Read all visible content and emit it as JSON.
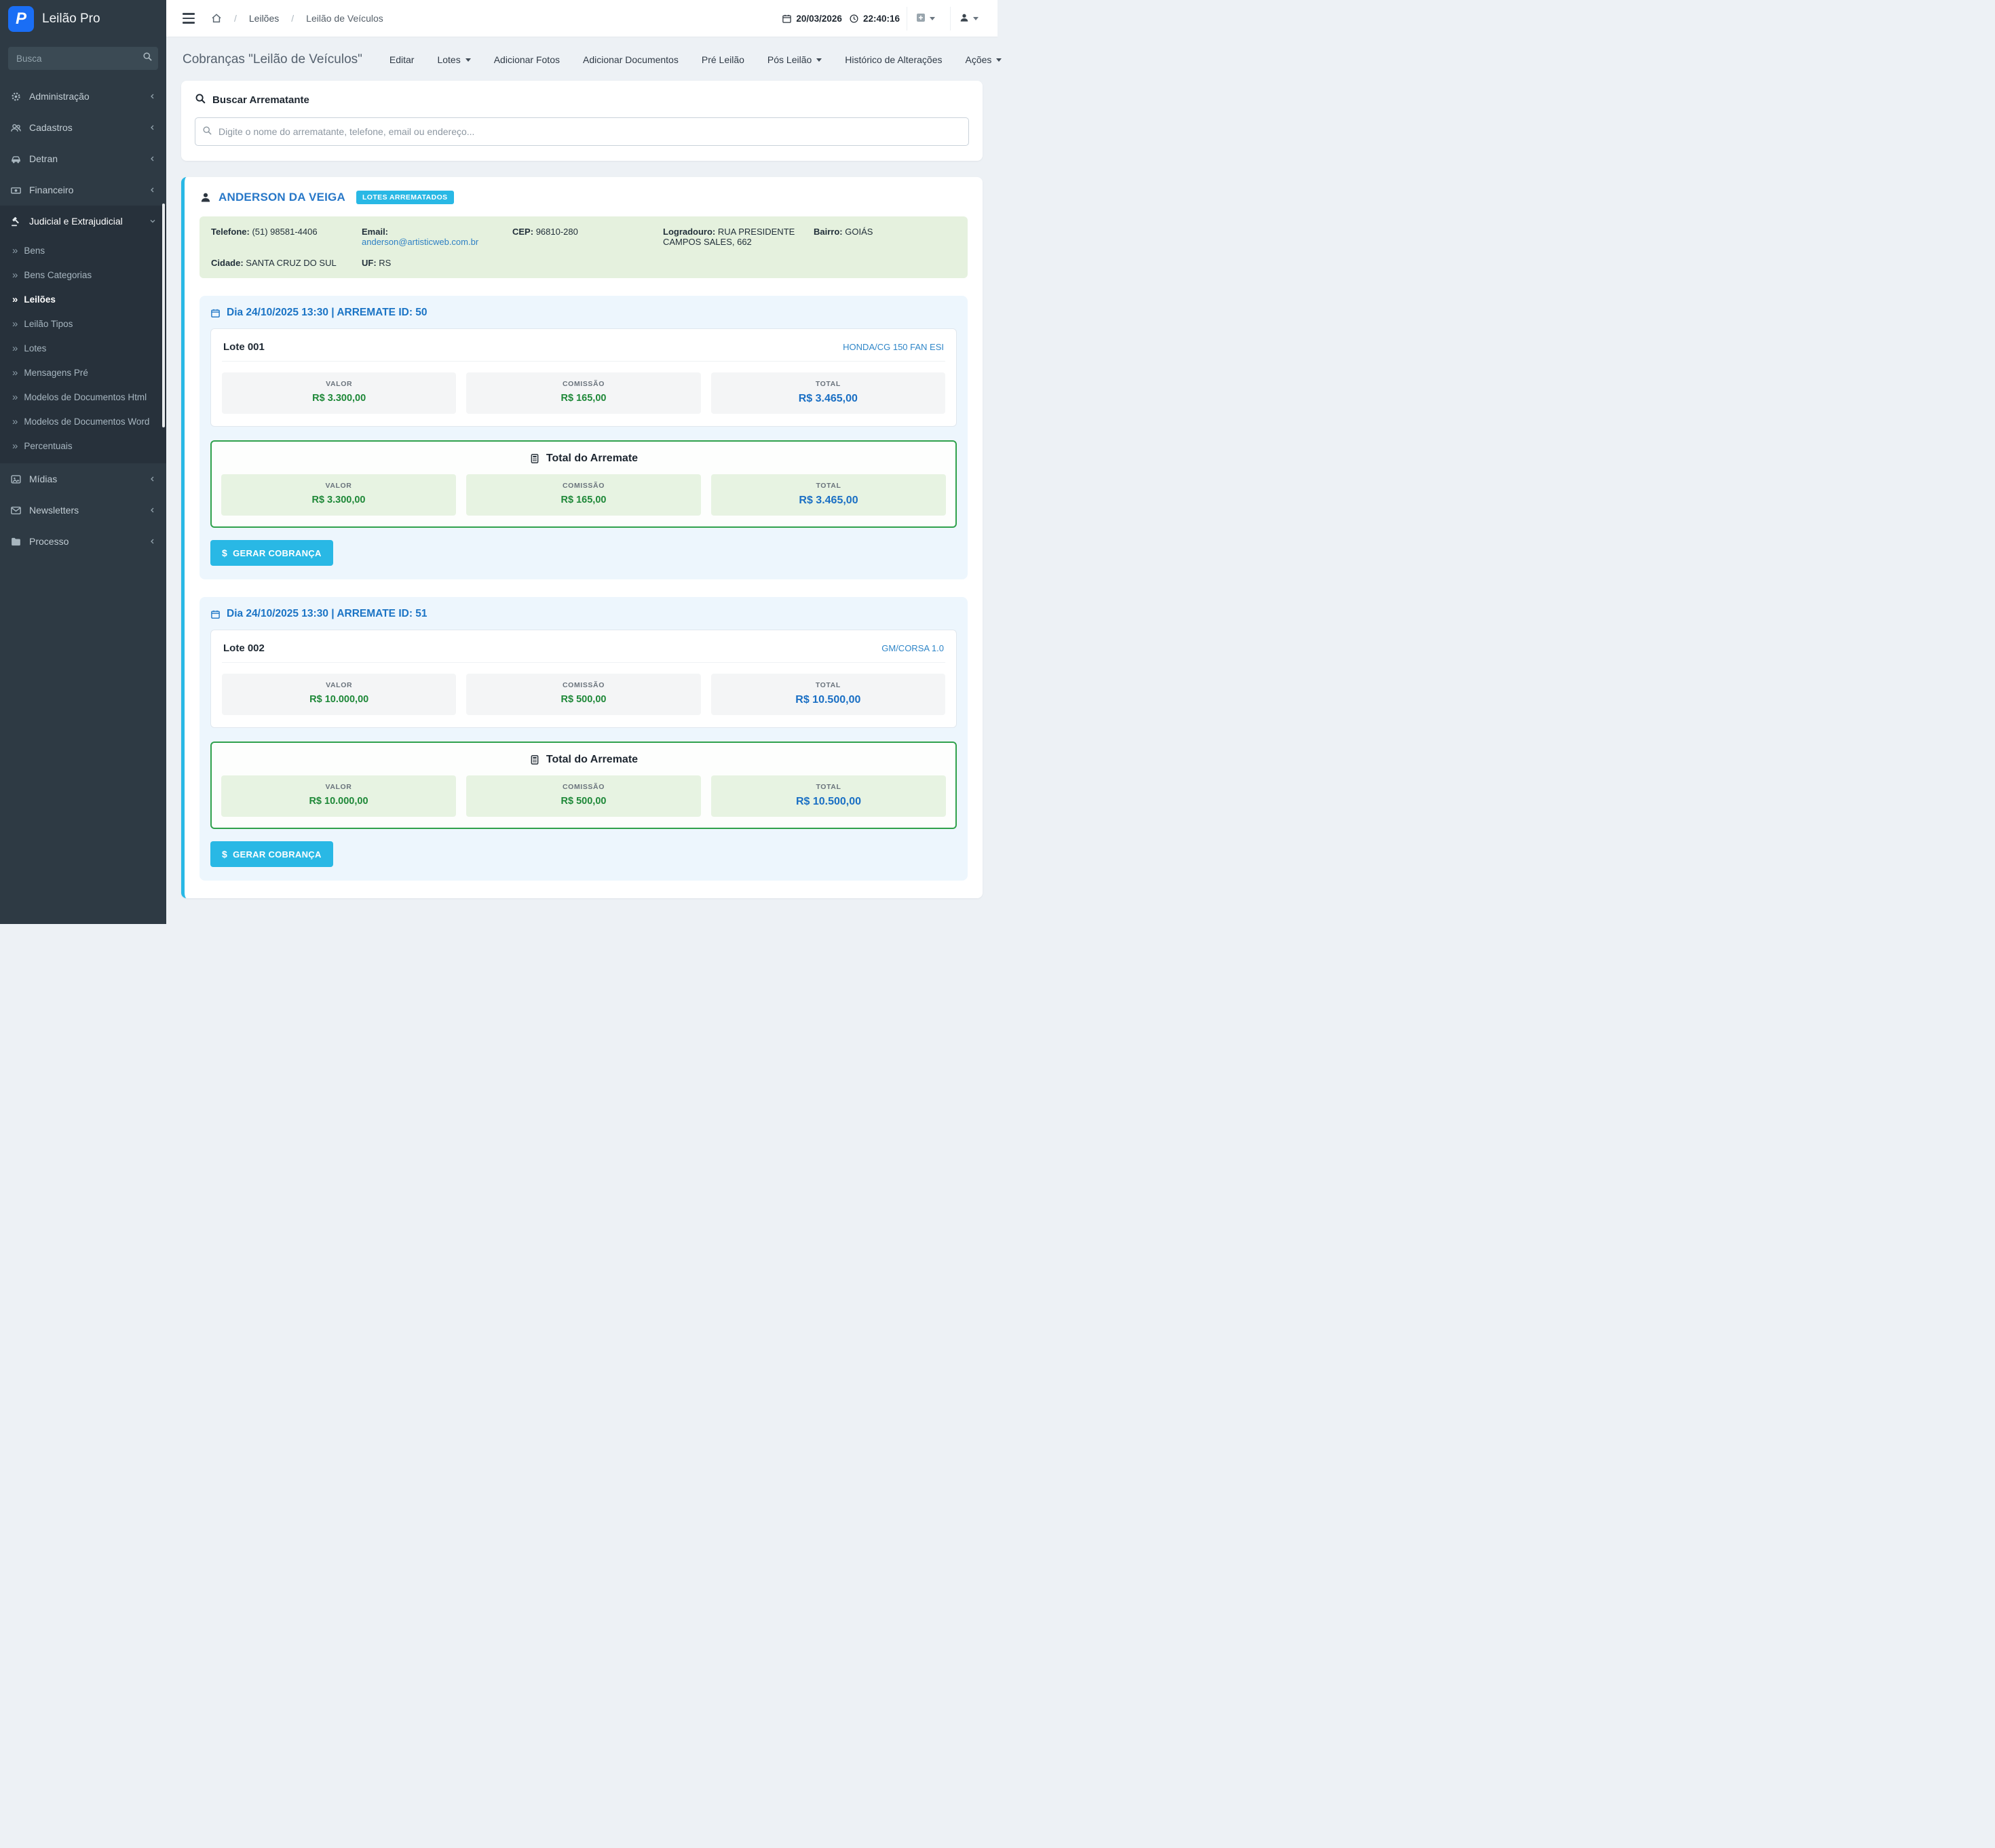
{
  "app": {
    "name": "Leilão Pro",
    "logo_letter": "P"
  },
  "topbar": {
    "breadcrumb": [
      {
        "label": "Leilões"
      },
      {
        "label": "Leilão de Veículos"
      }
    ],
    "date": "20/03/2026",
    "time": "22:40:16"
  },
  "sidebar": {
    "search_placeholder": "Busca",
    "items": [
      {
        "label": "Administração",
        "icon": "gears-icon"
      },
      {
        "label": "Cadastros",
        "icon": "users-icon"
      },
      {
        "label": "Detran",
        "icon": "car-icon"
      },
      {
        "label": "Financeiro",
        "icon": "money-icon"
      },
      {
        "label": "Judicial e Extrajudicial",
        "icon": "gavel-icon",
        "children": [
          {
            "label": "Bens"
          },
          {
            "label": "Bens Categorias"
          },
          {
            "label": "Leilões"
          },
          {
            "label": "Leilão Tipos"
          },
          {
            "label": "Lotes"
          },
          {
            "label": "Mensagens Pré"
          },
          {
            "label": "Modelos de Documentos Html"
          },
          {
            "label": "Modelos de Documentos Word"
          },
          {
            "label": "Percentuais"
          }
        ]
      },
      {
        "label": "Mídias",
        "icon": "image-icon"
      },
      {
        "label": "Newsletters",
        "icon": "envelope-icon"
      },
      {
        "label": "Processo",
        "icon": "folder-icon"
      }
    ]
  },
  "toolbar": {
    "title": "Cobranças \"Leilão de Veículos\"",
    "menu": [
      {
        "label": "Editar"
      },
      {
        "label": "Lotes",
        "dropdown": true
      },
      {
        "label": "Adicionar Fotos"
      },
      {
        "label": "Adicionar Documentos"
      },
      {
        "label": "Pré Leilão"
      },
      {
        "label": "Pós Leilão",
        "dropdown": true
      },
      {
        "label": "Histórico de Alterações"
      }
    ],
    "actions_label": "Ações"
  },
  "search": {
    "title": "Buscar Arrematante",
    "placeholder": "Digite o nome do arrematante, telefone, email ou endereço..."
  },
  "labels": {
    "valor": "VALOR",
    "comissao": "COMISSÃO",
    "total": "TOTAL"
  },
  "bidder": {
    "name": "ANDERSON DA VEIGA",
    "badge": "LOTES ARREMATADOS",
    "contact": {
      "telefone_label": "Telefone:",
      "telefone": "(51) 98581-4406",
      "email_label": "Email:",
      "email": "anderson@artisticweb.com.br",
      "cep_label": "CEP:",
      "cep": "96810-280",
      "logradouro_label": "Logradouro:",
      "logradouro": "RUA PRESIDENTE CAMPOS SALES, 662",
      "bairro_label": "Bairro:",
      "bairro": "GOIÁS",
      "cidade_label": "Cidade:",
      "cidade": "SANTA CRUZ DO SUL",
      "uf_label": "UF:",
      "uf": "RS"
    },
    "arremates": [
      {
        "heading": "Dia 24/10/2025 13:30 | ARREMATE ID: 50",
        "lote_label": "Lote 001",
        "vehicle": "HONDA/CG 150 FAN ESI",
        "valor": "R$ 3.300,00",
        "comissao": "R$ 165,00",
        "total": "R$ 3.465,00",
        "total_title": "Total do Arremate",
        "total_valor": "R$ 3.300,00",
        "total_comissao": "R$ 165,00",
        "total_total": "R$ 3.465,00",
        "button": "GERAR COBRANÇA"
      },
      {
        "heading": "Dia 24/10/2025 13:30 | ARREMATE ID: 51",
        "lote_label": "Lote 002",
        "vehicle": "GM/CORSA 1.0",
        "valor": "R$ 10.000,00",
        "comissao": "R$ 500,00",
        "total": "R$ 10.500,00",
        "total_title": "Total do Arremate",
        "total_valor": "R$ 10.000,00",
        "total_comissao": "R$ 500,00",
        "total_total": "R$ 10.500,00",
        "button": "GERAR COBRANÇA"
      }
    ]
  },
  "colors": {
    "accent_cyan": "#29b8e5",
    "green": "#1e8838",
    "blue": "#1a6fc4",
    "sidebar_bg": "#2e3a44",
    "contact_bg": "#e5f1de"
  }
}
